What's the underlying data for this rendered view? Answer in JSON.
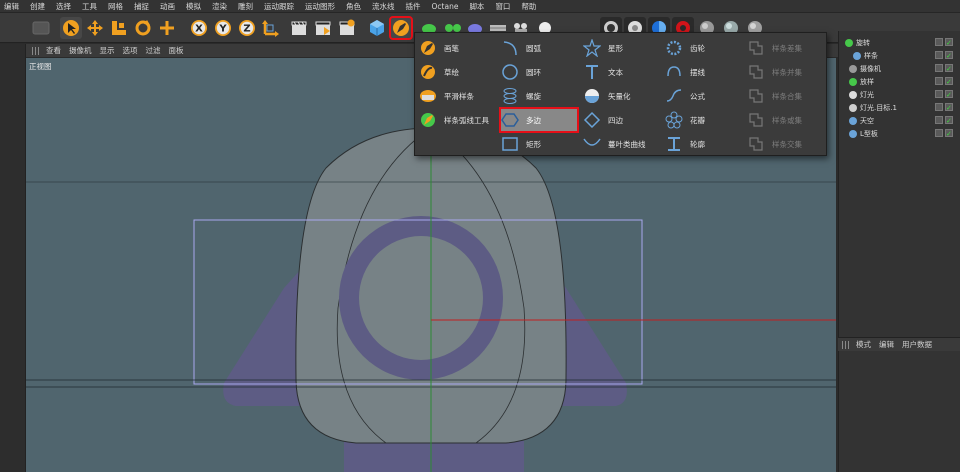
{
  "menubar": [
    "编辑",
    "创建",
    "选择",
    "工具",
    "网格",
    "捕捉",
    "动画",
    "模拟",
    "渲染",
    "雕刻",
    "运动跟踪",
    "运动图形",
    "角色",
    "流水线",
    "插件",
    "Octane",
    "脚本",
    "窗口",
    "帮助"
  ],
  "toolbar": {
    "axis_x": "X",
    "axis_y": "Y",
    "axis_z": "Z"
  },
  "viewport": {
    "menu": [
      "查看",
      "摄像机",
      "显示",
      "选项",
      "过滤",
      "面板"
    ],
    "label": "正视图",
    "background": "#50656e"
  },
  "spline_menu": {
    "col1": [
      {
        "label": "画笔",
        "icon": "pen-icon"
      },
      {
        "label": "草绘",
        "icon": "sketch-icon"
      },
      {
        "label": "平滑样条",
        "icon": "smooth-spline-icon"
      },
      {
        "label": "样条弧线工具",
        "icon": "spline-arc-tool-icon"
      }
    ],
    "col2": [
      {
        "label": "圆弧",
        "icon": "arc-icon"
      },
      {
        "label": "圆环",
        "icon": "circle-icon"
      },
      {
        "label": "螺旋",
        "icon": "helix-icon"
      },
      {
        "label": "多边",
        "icon": "polygon-icon",
        "selected": true
      },
      {
        "label": "矩形",
        "icon": "rectangle-icon"
      }
    ],
    "col3": [
      {
        "label": "星形",
        "icon": "star-icon"
      },
      {
        "label": "文本",
        "icon": "text-icon"
      },
      {
        "label": "矢量化",
        "icon": "vectorizer-icon"
      },
      {
        "label": "四边",
        "icon": "four-side-icon"
      },
      {
        "label": "蔓叶类曲线",
        "icon": "cissoid-icon"
      }
    ],
    "col4": [
      {
        "label": "齿轮",
        "icon": "cog-icon"
      },
      {
        "label": "摆线",
        "icon": "cycloid-icon"
      },
      {
        "label": "公式",
        "icon": "formula-icon"
      },
      {
        "label": "花瓣",
        "icon": "flower-icon"
      },
      {
        "label": "轮廓",
        "icon": "profile-icon"
      }
    ],
    "col5": [
      {
        "label": "样条差集",
        "icon": "spline-subtract-icon"
      },
      {
        "label": "样条并集",
        "icon": "spline-union-icon"
      },
      {
        "label": "样条合集",
        "icon": "spline-and-icon"
      },
      {
        "label": "样条或集",
        "icon": "spline-or-icon"
      },
      {
        "label": "样条交集",
        "icon": "spline-intersect-icon"
      }
    ]
  },
  "objects": [
    {
      "label": "旋转",
      "color": "#46c84a"
    },
    {
      "label": "样条",
      "color": "#6aa3d8"
    },
    {
      "label": "摄像机",
      "color": "#9a9a9a"
    },
    {
      "label": "放样",
      "color": "#46c84a"
    },
    {
      "label": "灯光",
      "color": "#dcdcdc"
    },
    {
      "label": "灯光.目标.1",
      "color": "#cfcfcf"
    },
    {
      "label": "天空",
      "color": "#6aa3d8"
    },
    {
      "label": "L型板",
      "color": "#6aa3d8"
    }
  ],
  "attributes": {
    "menu": [
      "模式",
      "编辑",
      "用户数据"
    ]
  },
  "colors": {
    "highlight": "#e60f18",
    "accent_orange": "#f0a020"
  }
}
